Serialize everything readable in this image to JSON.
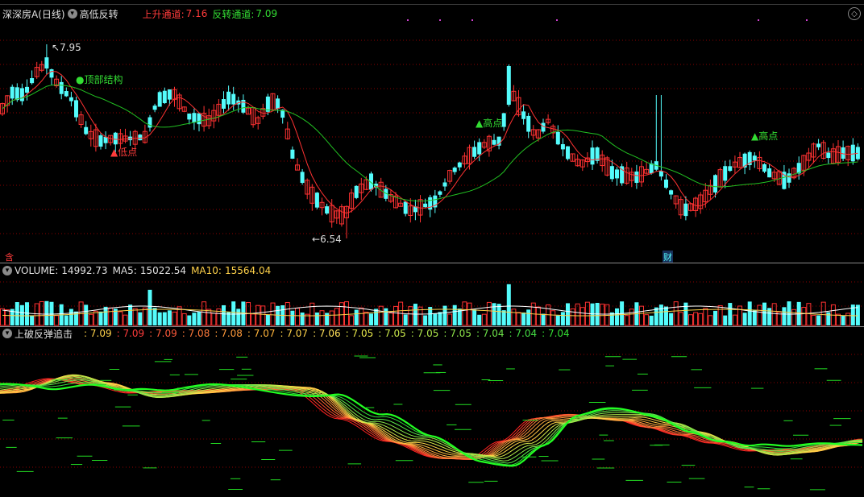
{
  "price_panel": {
    "stock_name": "深深房A",
    "period": "(日线)",
    "indicator": "高低反转",
    "ind_label1": "上升通道:",
    "ind_val1": "7.16",
    "ind_label2": "反转通道:",
    "ind_val2": "7.09",
    "annotations": {
      "high_price": "7.95",
      "low_price": "6.54",
      "top_structure": "●顶部结构",
      "high1": "▲高点",
      "low1": "▲低点",
      "high2": "▲高点",
      "marker_left": "含",
      "marker_right": "财"
    }
  },
  "volume_panel": {
    "label": "VOLUME:",
    "volume": "14992.73",
    "ma5_label": "MA5:",
    "ma5": "15022.54",
    "ma10_label": "MA10:",
    "ma10": "15564.04"
  },
  "osc_panel": {
    "label": "上破反弹追击",
    "values": [
      ": 7.09",
      ": 7.09",
      ": 7.09",
      ": 7.08",
      ": 7.08",
      ": 7.07",
      ": 7.07",
      ": 7.06",
      ": 7.05",
      ": 7.05",
      ": 7.05",
      ": 7.05",
      ": 7.04",
      ": 7.04",
      ": 7.04"
    ]
  },
  "colors": {
    "up": "#ff3232",
    "down": "#54fcfc",
    "ma_short": "#ff3232",
    "ma_long": "#22c122",
    "grid": "#8b0000",
    "yellow": "#ffd24a",
    "green_text": "#33dd33",
    "red_text": "#ff3b3b"
  }
}
